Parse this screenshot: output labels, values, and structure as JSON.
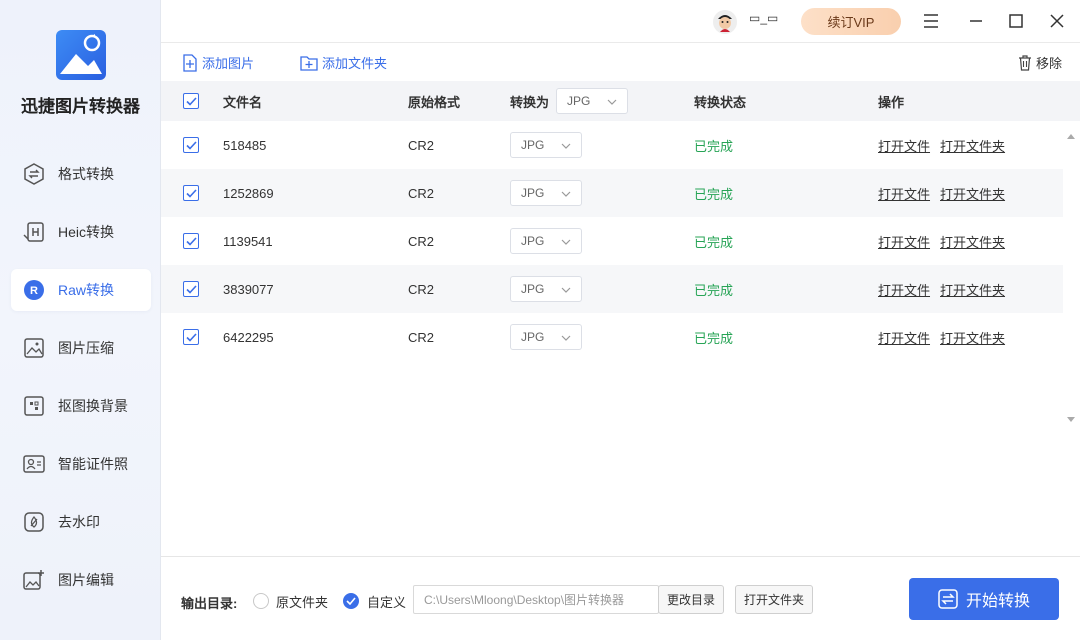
{
  "app": {
    "title": "迅捷图片转换器"
  },
  "sidebar": {
    "items": [
      {
        "label": "格式转换",
        "icon": "format-convert-icon",
        "active": false
      },
      {
        "label": "Heic转换",
        "icon": "heic-icon",
        "active": false
      },
      {
        "label": "Raw转换",
        "icon": "raw-icon",
        "active": true
      },
      {
        "label": "图片压缩",
        "icon": "compress-icon",
        "active": false
      },
      {
        "label": "抠图换背景",
        "icon": "cutout-icon",
        "active": false
      },
      {
        "label": "智能证件照",
        "icon": "id-photo-icon",
        "active": false
      },
      {
        "label": "去水印",
        "icon": "watermark-icon",
        "active": false
      },
      {
        "label": "图片编辑",
        "icon": "image-edit-icon",
        "active": false
      }
    ]
  },
  "titlebar": {
    "username": "▭_▭",
    "vip_label": "续订VIP"
  },
  "toolbar": {
    "add_image": "添加图片",
    "add_folder": "添加文件夹",
    "remove": "移除"
  },
  "table": {
    "headers": {
      "filename": "文件名",
      "original_format": "原始格式",
      "convert_to": "转换为",
      "convert_to_value": "JPG",
      "status": "转换状态",
      "actions": "操作"
    },
    "rows": [
      {
        "name": "518485",
        "format": "CR2",
        "target": "JPG",
        "status": "已完成",
        "open_file": "打开文件",
        "open_folder": "打开文件夹"
      },
      {
        "name": "1252869",
        "format": "CR2",
        "target": "JPG",
        "status": "已完成",
        "open_file": "打开文件",
        "open_folder": "打开文件夹"
      },
      {
        "name": "1139541",
        "format": "CR2",
        "target": "JPG",
        "status": "已完成",
        "open_file": "打开文件",
        "open_folder": "打开文件夹"
      },
      {
        "name": "3839077",
        "format": "CR2",
        "target": "JPG",
        "status": "已完成",
        "open_file": "打开文件",
        "open_folder": "打开文件夹"
      },
      {
        "name": "6422295",
        "format": "CR2",
        "target": "JPG",
        "status": "已完成",
        "open_file": "打开文件",
        "open_folder": "打开文件夹"
      }
    ]
  },
  "bottom": {
    "output_label": "输出目录:",
    "option_original": "原文件夹",
    "option_custom": "自定义",
    "selected": "custom",
    "path_value": "C:\\Users\\Mloong\\Desktop\\图片转换器",
    "change_dir": "更改目录",
    "open_folder": "打开文件夹",
    "start": "开始转换"
  },
  "colors": {
    "accent": "#3a6ee8",
    "success": "#27a456",
    "vip_bg": "#fbd7bb"
  }
}
